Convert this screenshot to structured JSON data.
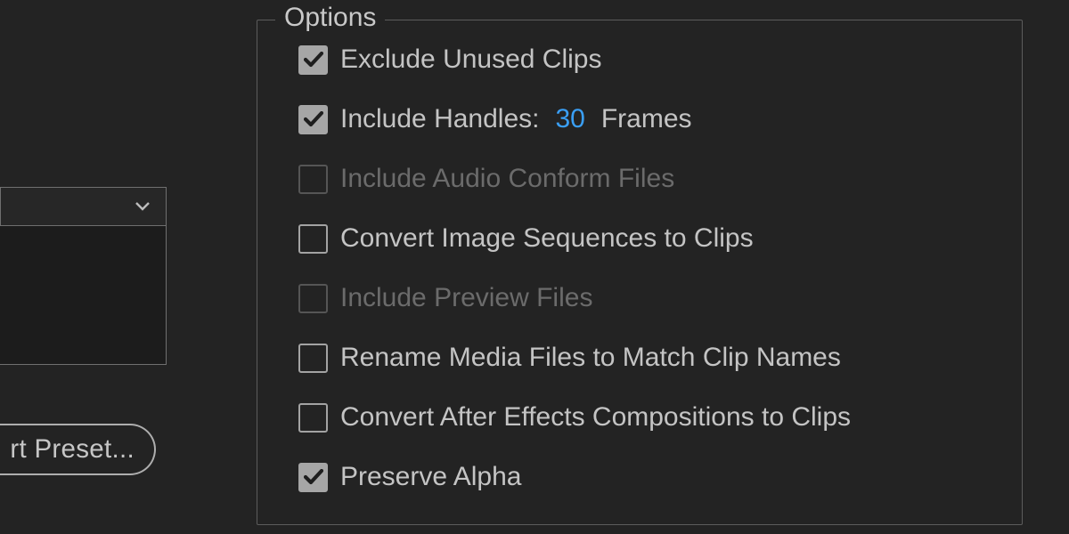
{
  "leftPanel": {
    "presetButtonLabel": "rt Preset..."
  },
  "optionsGroup": {
    "legend": "Options",
    "items": [
      {
        "label": "Exclude Unused Clips",
        "checked": true,
        "disabled": false
      },
      {
        "label": "Include Handles:",
        "checked": true,
        "disabled": false,
        "value": "30",
        "suffix": "Frames"
      },
      {
        "label": "Include Audio Conform Files",
        "checked": false,
        "disabled": true
      },
      {
        "label": "Convert Image Sequences to Clips",
        "checked": false,
        "disabled": false
      },
      {
        "label": "Include Preview Files",
        "checked": false,
        "disabled": true
      },
      {
        "label": "Rename Media Files to Match Clip Names",
        "checked": false,
        "disabled": false
      },
      {
        "label": "Convert After Effects Compositions to Clips",
        "checked": false,
        "disabled": false
      },
      {
        "label": "Preserve Alpha",
        "checked": true,
        "disabled": false
      }
    ]
  }
}
